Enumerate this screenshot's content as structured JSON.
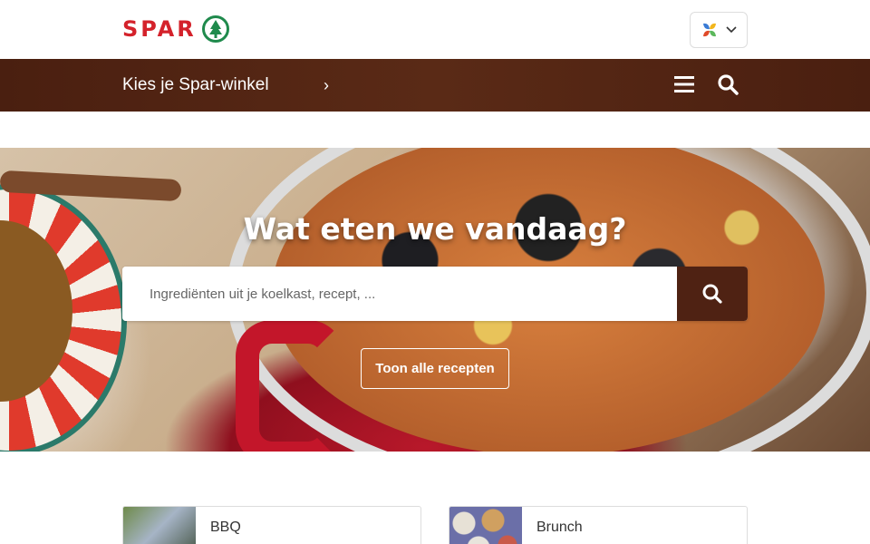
{
  "header": {
    "logo_text": "SPAR",
    "logo_icon": "spar-tree-icon",
    "language_icon": "language-flag-icon",
    "colors": {
      "brand_red": "#d4222b",
      "brand_green": "#1f8a4c"
    }
  },
  "nav": {
    "store_picker_label": "Kies je Spar-winkel",
    "store_picker_icon": "chevron-right-icon",
    "menu_icon": "hamburger-menu-icon",
    "search_icon": "search-icon",
    "background": "#4f2213"
  },
  "hero": {
    "title": "Wat eten we vandaag?",
    "search_placeholder": "Ingrediënten uit je koelkast, recept, ...",
    "search_value": "",
    "search_button_icon": "search-icon",
    "all_recipes_label": "Toon alle recepten"
  },
  "categories": [
    {
      "label": "BBQ",
      "icon": "arrow-right-icon"
    },
    {
      "label": "Brunch",
      "icon": "arrow-right-icon"
    }
  ]
}
